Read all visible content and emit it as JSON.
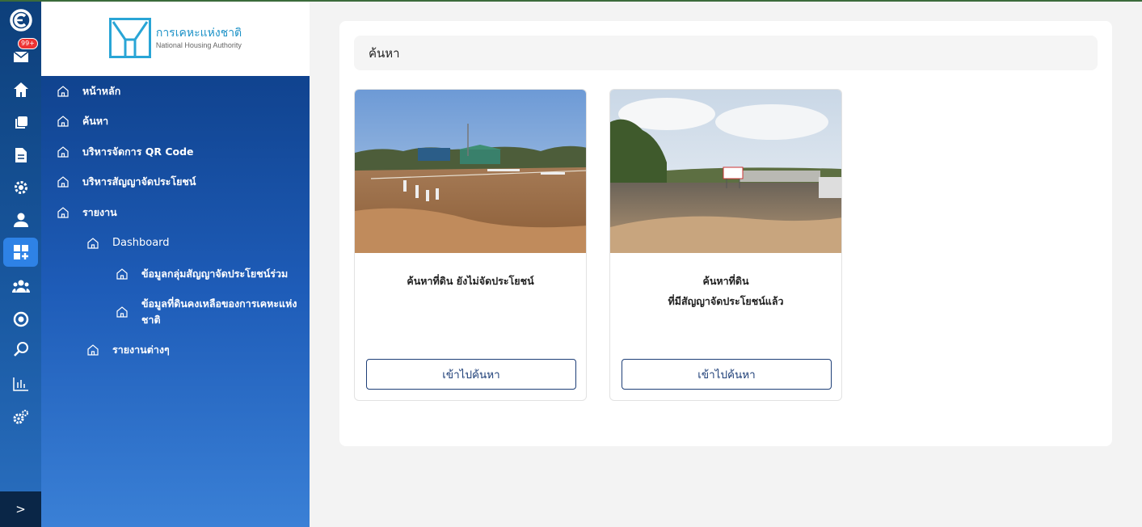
{
  "rail": {
    "badge": "99+",
    "icons": [
      "brand-icon",
      "inbox-icon",
      "home-icon",
      "copy-icon",
      "document-icon",
      "settings-icon",
      "user-icon",
      "dashboard-icon",
      "group-icon",
      "chip-icon",
      "search-icon",
      "chart-icon",
      "cogs-icon"
    ],
    "footer": ">"
  },
  "logo": {
    "thai": "การเคหะแห่งชาติ",
    "english": "National Housing Authority"
  },
  "sidebar": {
    "items": [
      {
        "label": "หน้าหลัก"
      },
      {
        "label": "ค้นหา"
      },
      {
        "label": "บริหารจัดการ QR Code"
      },
      {
        "label": "บริหารสัญญาจัดประโยชน์"
      },
      {
        "label": "รายงาน"
      },
      {
        "label": "Dashboard"
      },
      {
        "label": "ข้อมูลกลุ่มสัญญาจัดประโยชน์ร่วม"
      },
      {
        "label": "ข้อมูลที่ดินคงเหลือของการเคหะแห่งชาติ"
      },
      {
        "label": "รายงานต่างๆ"
      }
    ]
  },
  "main": {
    "heading": "ค้นหา",
    "cards": [
      {
        "title_lines": [
          "ค้นหาที่ดิน ยังไม่จัดประโยชน์",
          ""
        ],
        "button": "เข้าไปค้นหา",
        "sign_text": ""
      },
      {
        "title_lines": [
          "ค้นหาที่ดิน",
          "ที่มีสัญญาจัดประโยชน์แล้ว"
        ],
        "button": "เข้าไปค้นหา",
        "sign_text": ""
      }
    ]
  },
  "colors": {
    "accent": "#2e82e6",
    "nav_dark": "#0b3a80",
    "button_border": "#1e3f78",
    "logo_blue": "#29a5d6"
  }
}
